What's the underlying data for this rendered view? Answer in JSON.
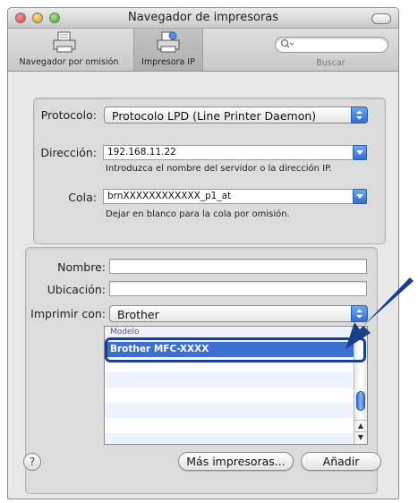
{
  "window": {
    "title": "Navegador de impresoras"
  },
  "toolbar": {
    "default_browser_label": "Navegador por omisión",
    "ip_printer_label": "Impresora IP",
    "search_placeholder": "",
    "search_label": "Buscar"
  },
  "group1": {
    "protocol_label": "Protocolo:",
    "protocol_value": "Protocolo LPD (Line Printer Daemon)",
    "address_label": "Dirección:",
    "address_value": "192.168.11.22",
    "address_hint": "Introduzca el nombre del servidor o la dirección IP.",
    "queue_label": "Cola:",
    "queue_value": "brnXXXXXXXXXXXX_p1_at",
    "queue_hint": "Dejar en blanco para la cola por omisión."
  },
  "group2": {
    "name_label": "Nombre:",
    "name_value": "",
    "location_label": "Ubicación:",
    "location_value": "",
    "print_with_label": "Imprimir con:",
    "print_with_value": "Brother",
    "model_list_header": "Modelo",
    "models": [
      "Brother MFC-XXXX"
    ],
    "selected_model_index": 0
  },
  "buttons": {
    "help": "?",
    "more_printers": "Más impresoras...",
    "add": "Añadir"
  },
  "colors": {
    "selection": "#3d6fcf",
    "accent_blue": "#2f6fd3",
    "callout_arrow": "#1b3e8a"
  }
}
